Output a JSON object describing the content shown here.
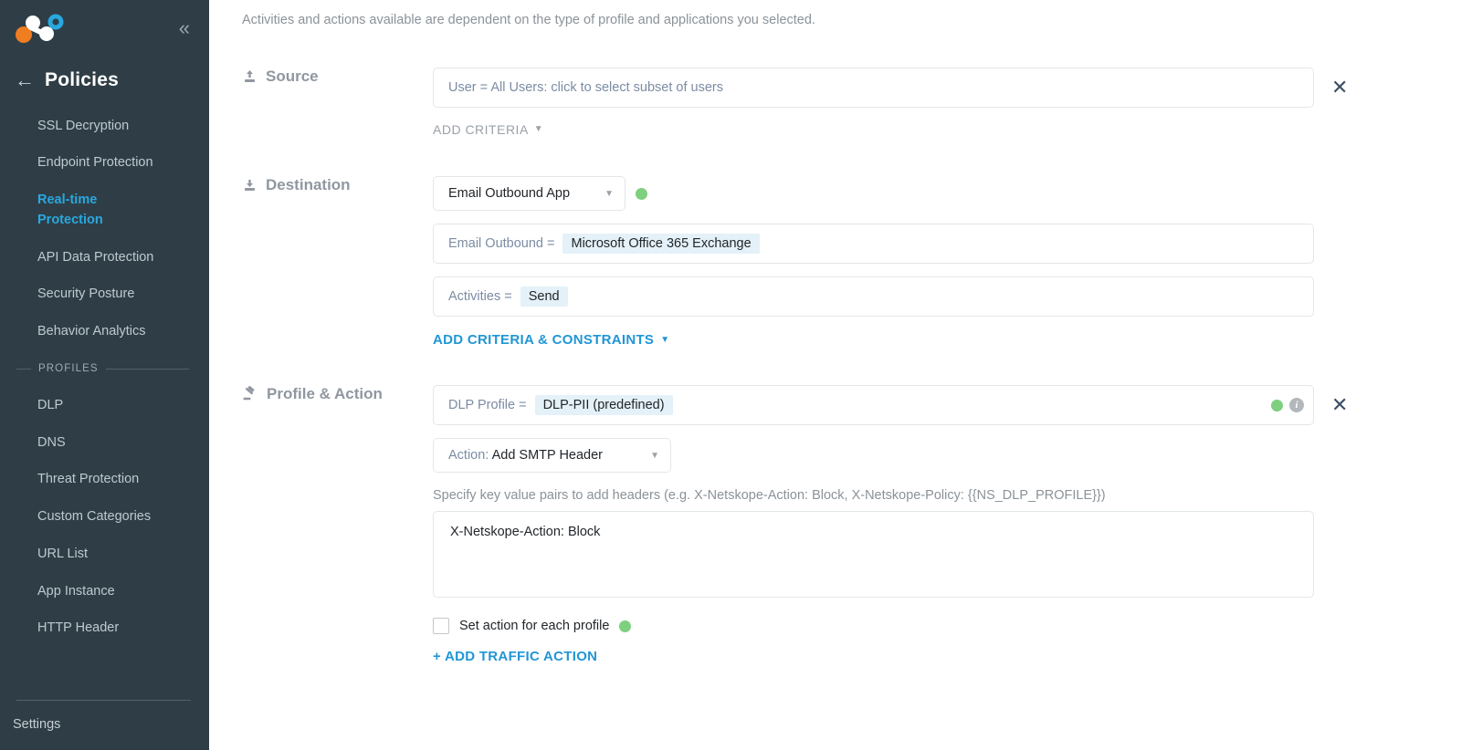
{
  "sidebar": {
    "logo_name": "netskope-logo",
    "collapse_icon": "chevron-double-left-icon",
    "back_icon": "arrow-left-icon",
    "title": "Policies",
    "items": [
      {
        "label": "SSL Decryption",
        "active": false
      },
      {
        "label": "Endpoint Protection",
        "active": false
      },
      {
        "label": "Real-time Protection",
        "active": true
      },
      {
        "label": "API Data Protection",
        "active": false
      },
      {
        "label": "Security Posture",
        "active": false
      },
      {
        "label": "Behavior Analytics",
        "active": false
      }
    ],
    "profiles_section_label": "PROFILES",
    "profile_items": [
      {
        "label": "DLP"
      },
      {
        "label": "DNS"
      },
      {
        "label": "Threat Protection"
      },
      {
        "label": "Custom Categories"
      },
      {
        "label": "URL List"
      },
      {
        "label": "App Instance"
      },
      {
        "label": "HTTP Header"
      }
    ],
    "settings_label": "Settings"
  },
  "main": {
    "intro_text": "Activities and actions available are dependent on the type of profile and applications you selected.",
    "source": {
      "icon": "upload-icon",
      "label": "Source",
      "value": "User = All Users: click to select subset of users",
      "remove_icon": "close-icon",
      "add_criteria_label": "ADD CRITERIA",
      "caret_icon": "caret-down-icon"
    },
    "destination": {
      "icon": "download-icon",
      "label": "Destination",
      "select_value": "Email Outbound App",
      "select_caret_icon": "caret-down-icon",
      "status_dot_icon": "green-status-dot",
      "criteria_label": "Email Outbound =",
      "criteria_chip": "Microsoft Office 365 Exchange",
      "activities_label": "Activities =",
      "activities_chip": "Send",
      "add_criteria_label": "ADD CRITERIA & CONSTRAINTS",
      "caret_icon": "caret-down-icon"
    },
    "profile_action": {
      "icon": "gavel-icon",
      "label": "Profile & Action",
      "dlp_label": "DLP Profile =",
      "dlp_chip": "DLP-PII (predefined)",
      "status_dot_icon": "green-status-dot",
      "info_icon": "info-icon",
      "info_glyph": "i",
      "remove_icon": "close-icon",
      "action_prefix": "Action:",
      "action_value": "Add SMTP Header",
      "action_caret_icon": "caret-down-icon",
      "hint": "Specify key value pairs to add headers (e.g. X-Netskope-Action: Block, X-Netskope-Policy: {{NS_DLP_PROFILE}})",
      "headers_value": "X-Netskope-Action: Block",
      "checkbox_label": "Set action for each profile",
      "checkbox_dot_icon": "green-status-dot",
      "checkbox_checked": false,
      "add_traffic_action_label": "+ ADD TRAFFIC ACTION"
    }
  },
  "colors": {
    "sidebar_bg": "#2f3e46",
    "accent_blue": "#29a8e0",
    "link_blue": "#2196d6",
    "chip_bg": "#e4f1f8",
    "status_green": "#7ed07e",
    "logo_orange": "#f07d20",
    "logo_blue": "#29a8e0"
  }
}
